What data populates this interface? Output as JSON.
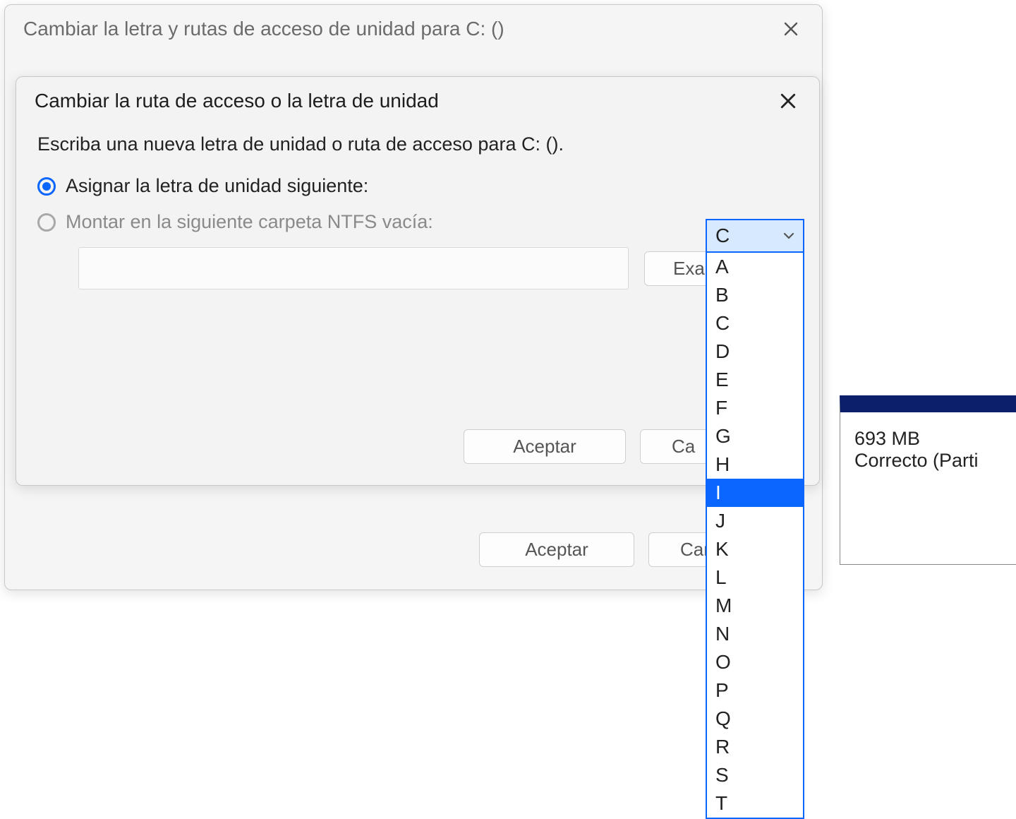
{
  "outer": {
    "title": "Cambiar la letra y rutas de acceso de unidad para C: ()",
    "accept": "Aceptar",
    "cancel": "Can"
  },
  "inner": {
    "title": "Cambiar la ruta de acceso o la letra de unidad",
    "instruction": "Escriba una nueva letra de unidad o ruta de acceso para C: ().",
    "radio_assign": "Asignar la letra de unidad siguiente:",
    "radio_mount": "Montar en la siguiente carpeta NTFS vacía:",
    "browse": "Exa",
    "accept": "Aceptar",
    "cancel": "Ca"
  },
  "combo": {
    "selected": "C",
    "highlighted": "I",
    "options": [
      "A",
      "B",
      "C",
      "D",
      "E",
      "F",
      "G",
      "H",
      "I",
      "J",
      "K",
      "L",
      "M",
      "N",
      "O",
      "P",
      "Q",
      "R",
      "S",
      "T"
    ]
  },
  "partition": {
    "size": "693 MB",
    "status": "Correcto (Parti"
  }
}
